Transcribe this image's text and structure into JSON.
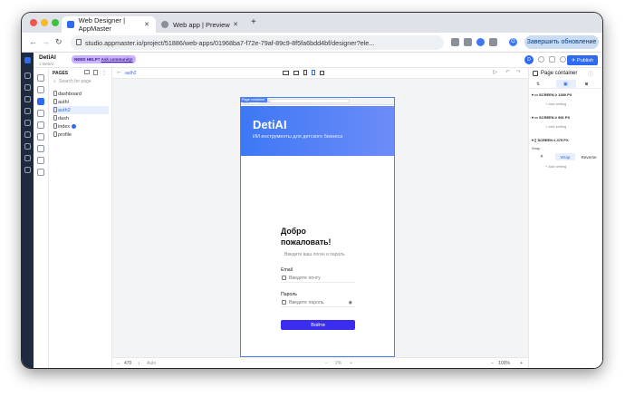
{
  "browser": {
    "tabs": [
      {
        "label": "Web Designer | AppMaster"
      },
      {
        "label": "Web app | Preview"
      }
    ],
    "new_tab": "+",
    "url": "studio.appmaster.io/project/51886/web-apps/01968ba7-f72e-79af-89c9-8f5fa6bdd4bf/designer?ele...",
    "update_button": "Завершить обновление",
    "profile_initial": "G"
  },
  "app": {
    "project_name": "DetiAI",
    "project_sub": "≡ DetiAI",
    "help_badge": "NEED HELP?",
    "help_link": "Ask community!",
    "publish_label": "Publish",
    "user_initial": "D",
    "pages_title": "PAGES",
    "search_placeholder": "Search for page",
    "pages": [
      {
        "name": "dashboard"
      },
      {
        "name": "authl"
      },
      {
        "name": "auth2"
      },
      {
        "name": "dash"
      },
      {
        "name": "index"
      },
      {
        "name": "profile"
      }
    ],
    "current_page": "auth2",
    "canvas_url": "auth2",
    "page_container_label": "Page container",
    "hero_title": "DetiAI",
    "hero_subtitle": "ИИ инструменты для детского бизнеса",
    "welcome": "Добро пожаловать!",
    "login_hint": "Введите ваш логин и пароль",
    "email_label": "Email",
    "email_placeholder": "Введите почту",
    "password_label": "Пароль",
    "password_placeholder": "Введите пароль",
    "login_button": "Войти",
    "bottom": {
      "width": "470",
      "height": "Auto",
      "zoom": "2%",
      "zoom2": "100%"
    },
    "right_panel": {
      "title": "Page container",
      "screens": [
        {
          "label": "SCREEN ≥ 1280 PX"
        },
        {
          "label": "SCREEN ≥ 991 PX"
        },
        {
          "label": "SCREEN ≤ 479 PX"
        }
      ],
      "add_setting": "Add setting",
      "wrap_label": "Wrap",
      "wrap_options": [
        "✕",
        "Wrap",
        "Reverse"
      ]
    }
  }
}
